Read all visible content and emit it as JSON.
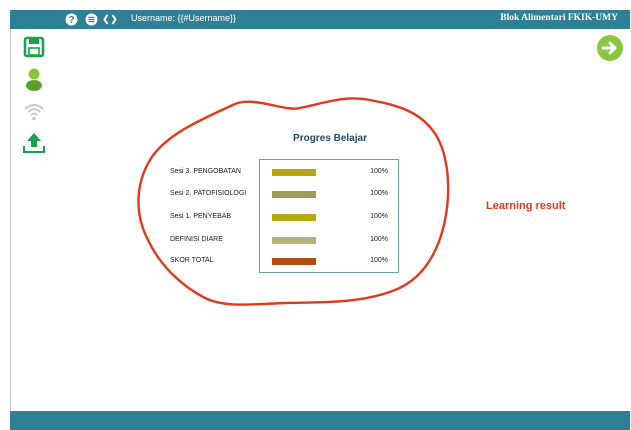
{
  "topbar": {
    "username": "Username:  {{#Username}}",
    "course": "Blok Alimentari FKIK-UMY",
    "icons": [
      "help-icon",
      "menu-icon",
      "code-icon"
    ]
  },
  "sidebar": {
    "icons": [
      "save-icon",
      "user-icon",
      "wifi-icon",
      "upload-icon"
    ]
  },
  "next_button": {
    "icon": "arrow-right-icon"
  },
  "progress": {
    "title": "Progres Belajar",
    "rows": [
      {
        "label": "Sesi 3. PENGOBATAN",
        "percent": "100%",
        "value": 100,
        "color": "#b5a80f"
      },
      {
        "label": "Sesi 2. PATOFISIOLOGI",
        "percent": "100%",
        "value": 100,
        "color": "#a39a5a"
      },
      {
        "label": "Sesi 1. PENYEBAB",
        "percent": "100%",
        "value": 100,
        "color": "#b5ab0f"
      },
      {
        "label": "DEFINISI DIARE",
        "percent": "100%",
        "value": 100,
        "color": "#b7b07a"
      },
      {
        "label": "SKOR TOTAL",
        "percent": "100%",
        "value": 100,
        "color": "#b34d14"
      }
    ]
  },
  "annotation": {
    "text": "Learning result",
    "color": "#e2391c"
  }
}
